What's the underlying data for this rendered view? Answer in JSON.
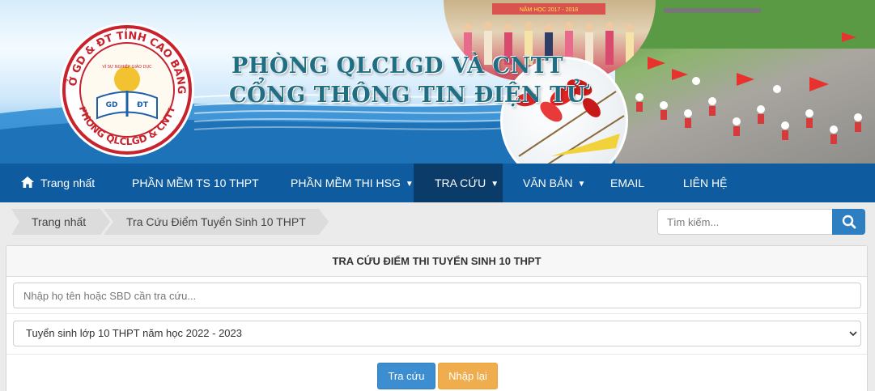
{
  "banner": {
    "title": "PHÒNG QLCLGD VÀ CNTT",
    "subtitle": "CỔNG THÔNG TIN ĐIỆN TỬ",
    "logo_text": "SỞ GD & ĐT TỈNH CAO BẰNG · PHÒNG QLCLGD & CNTT · VÌ SỰ NGHIỆP GIÁO DỤC · GD ĐT",
    "photo_caption": "NĂM HỌC 2017 - 2018",
    "colors": {
      "title": "#1f6e83",
      "sky": "#5db0e6"
    }
  },
  "nav": {
    "items": [
      {
        "label": "Trang nhất",
        "icon": "home-icon"
      },
      {
        "label": "PHẦN MỀM TS 10 THPT"
      },
      {
        "label": "PHẦN MỀM THI HSG",
        "caret": "▼"
      },
      {
        "label": "TRA CỨU",
        "caret": "▼",
        "active": true
      },
      {
        "label": "VĂN BẢN",
        "caret": "▼"
      },
      {
        "label": "EMAIL"
      },
      {
        "label": "LIÊN HỆ"
      }
    ],
    "colors": {
      "background": "#0e5c9f",
      "active": "#0b3b68"
    }
  },
  "breadcrumb": {
    "items": [
      "Trang nhất",
      "Tra Cứu Điểm Tuyển Sinh 10 THPT"
    ]
  },
  "search": {
    "placeholder": "Tìm kiếm...",
    "icon": "search-icon"
  },
  "panel": {
    "heading": "TRA CỨU ĐIỂM THI TUYỂN SINH 10 THPT",
    "name_input_placeholder": "Nhập họ tên hoặc SBD cần tra cứu...",
    "exam_select_value": "Tuyển sinh lớp 10 THPT năm học 2022 - 2023",
    "submit_label": "Tra cứu",
    "reset_label": "Nhập lại",
    "colors": {
      "primary": "#3d8ed0",
      "warning": "#f0ad4e"
    }
  }
}
